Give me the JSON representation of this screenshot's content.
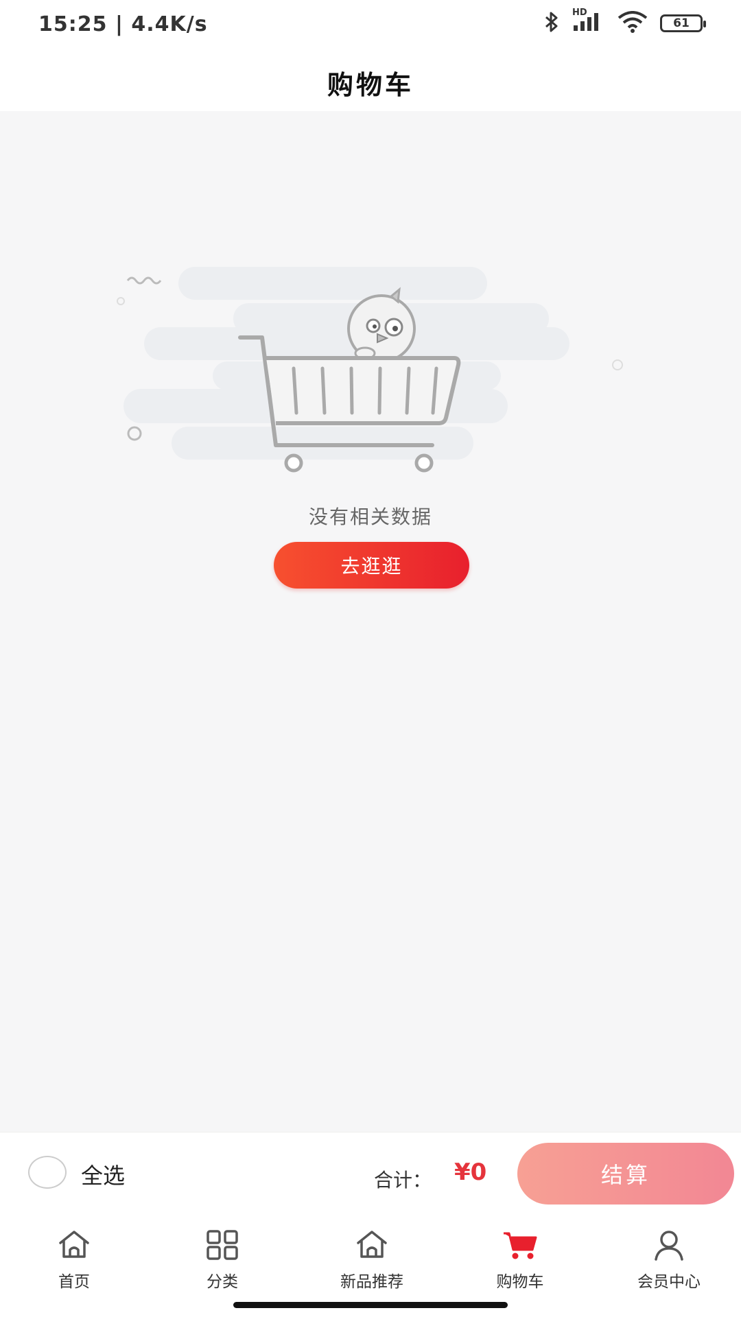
{
  "status_bar": {
    "time_speed": "15:25 | 4.4K/s",
    "hd_label": "HD",
    "battery_level": "61",
    "icons": [
      "bluetooth-icon",
      "signal-icon",
      "wifi-icon",
      "battery-icon"
    ]
  },
  "header": {
    "title": "购物车"
  },
  "empty_state": {
    "message": "没有相关数据",
    "button_label": "去逛逛"
  },
  "checkout_bar": {
    "select_all_label": "全选",
    "total_label": "合计：",
    "total_value": "¥0",
    "checkout_label": "结算"
  },
  "tab_bar": {
    "items": [
      {
        "label": "首页",
        "icon": "home-icon",
        "active": false
      },
      {
        "label": "分类",
        "icon": "grid-icon",
        "active": false
      },
      {
        "label": "新品推荐",
        "icon": "home-icon",
        "active": false
      },
      {
        "label": "购物车",
        "icon": "cart-icon",
        "active": true
      },
      {
        "label": "会员中心",
        "icon": "user-icon",
        "active": false
      }
    ]
  },
  "colors": {
    "accent": "#e8202d",
    "checkout_gradient_start": "#f7a094",
    "checkout_gradient_end": "#f28794",
    "background": "#f6f6f7"
  }
}
